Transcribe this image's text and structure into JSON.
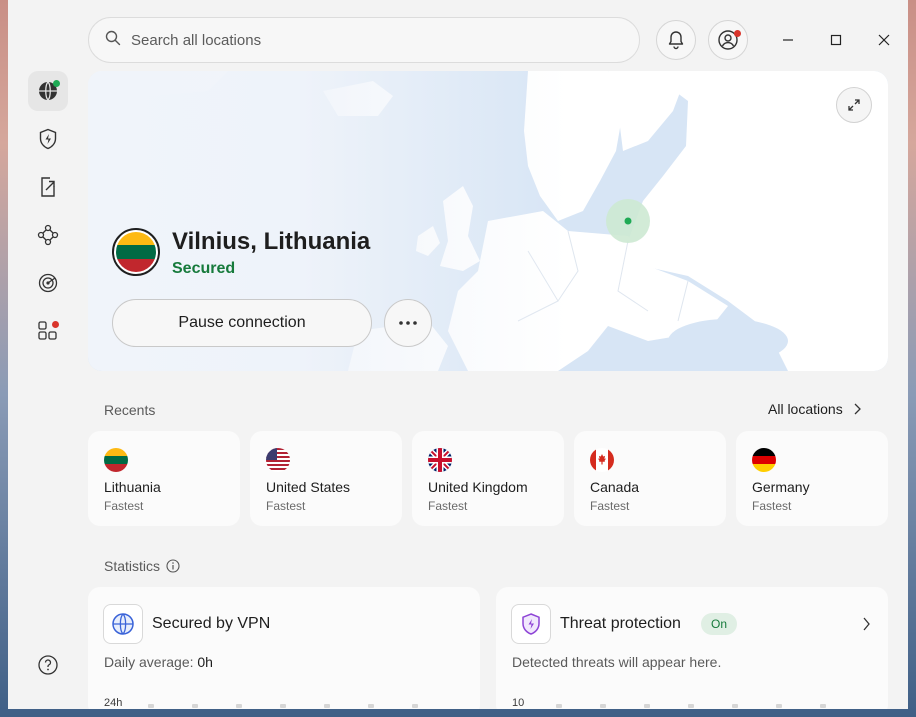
{
  "search": {
    "placeholder": "Search all locations"
  },
  "location": {
    "name": "Vilnius, Lithuania",
    "status": "Secured",
    "pause_label": "Pause connection"
  },
  "recents": {
    "label": "Recents",
    "all_locations_label": "All locations",
    "items": [
      {
        "country": "Lithuania",
        "sub": "Fastest"
      },
      {
        "country": "United States",
        "sub": "Fastest"
      },
      {
        "country": "United Kingdom",
        "sub": "Fastest"
      },
      {
        "country": "Canada",
        "sub": "Fastest"
      },
      {
        "country": "Germany",
        "sub": "Fastest"
      }
    ]
  },
  "statistics": {
    "label": "Statistics",
    "vpn": {
      "title": "Secured by VPN",
      "daily_label": "Daily average:",
      "daily_value": "0h",
      "axis_top": "24h"
    },
    "threat": {
      "title": "Threat protection",
      "badge": "On",
      "text": "Detected threats will appear here.",
      "axis_top": "10"
    }
  },
  "colors": {
    "accent_green": "#167a3b",
    "notification_red": "#d9342b",
    "map_water": "#d7e5f5",
    "map_land": "#ffffff"
  }
}
